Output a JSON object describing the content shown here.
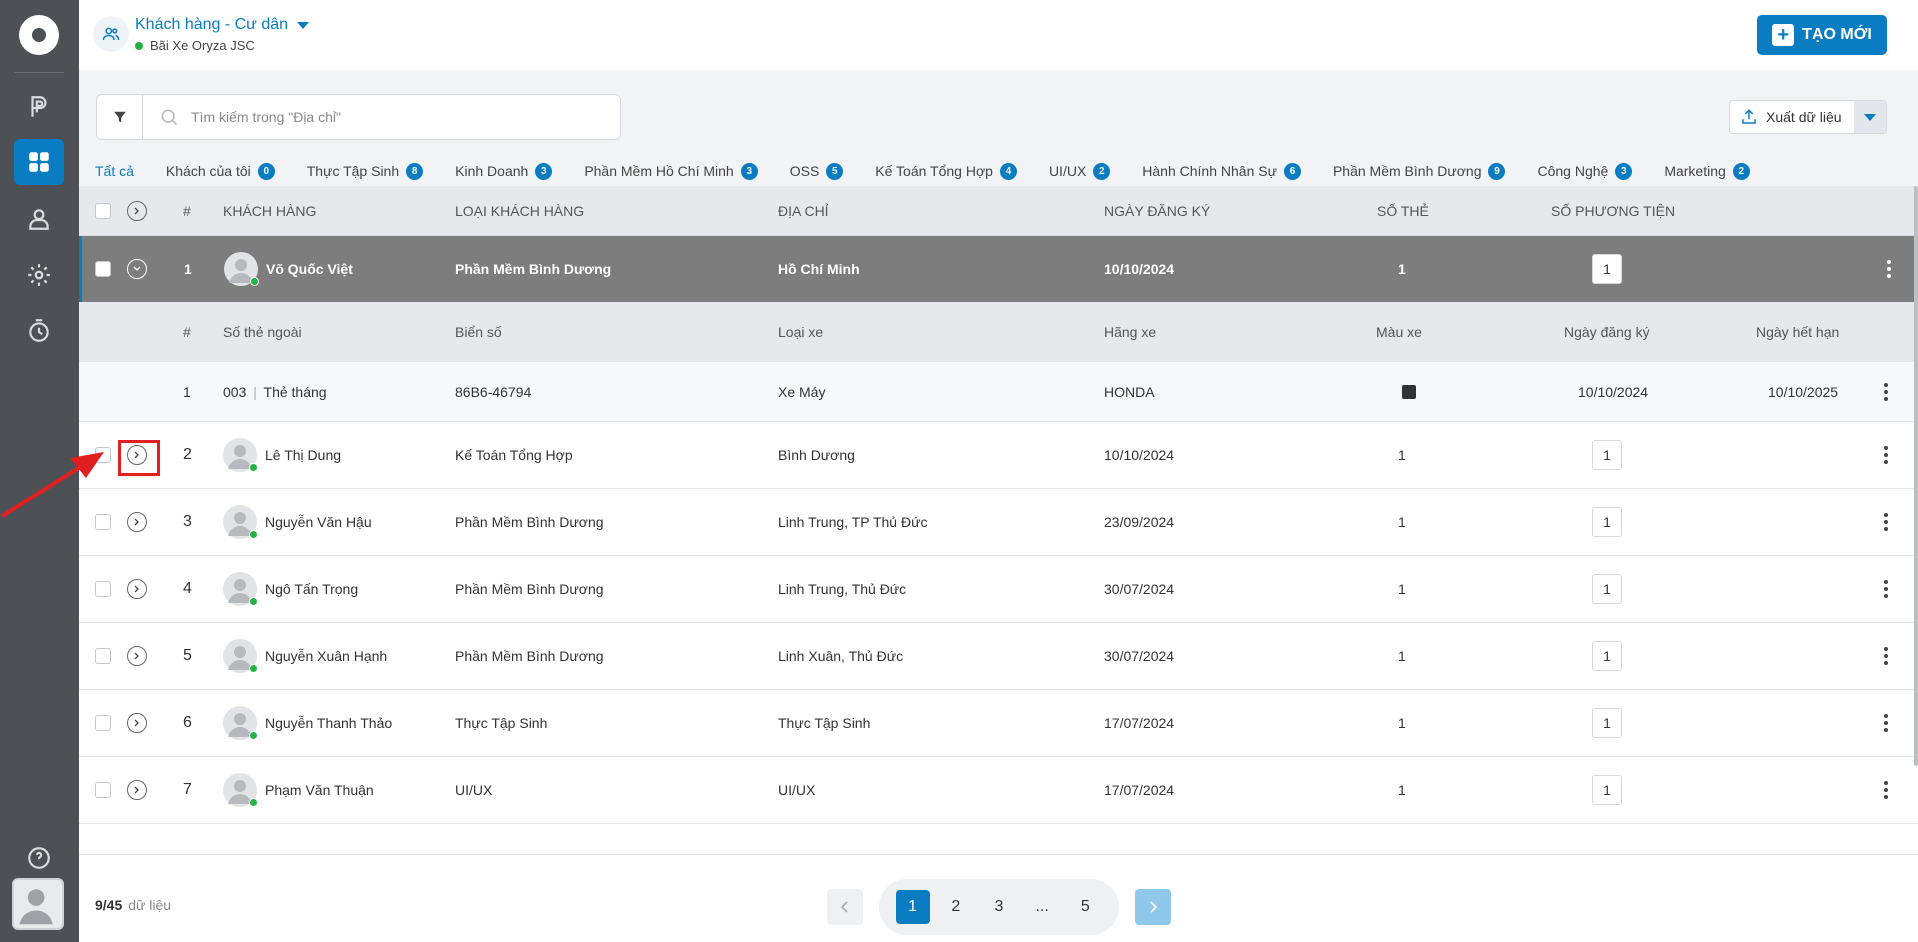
{
  "header": {
    "title": "Khách hàng - Cư dân",
    "subtitle": "Bãi Xe Oryza JSC",
    "create_label": "TẠO MỚI"
  },
  "search": {
    "placeholder": "Tìm kiếm trong \"Địa chỉ\""
  },
  "export": {
    "label": "Xuất dữ liệu"
  },
  "tabs": [
    {
      "label": "Tất cả",
      "badge": ""
    },
    {
      "label": "Khách của tôi",
      "badge": "0"
    },
    {
      "label": "Thực Tập Sinh",
      "badge": "8"
    },
    {
      "label": "Kinh Doanh",
      "badge": "3"
    },
    {
      "label": "Phần Mềm Hồ Chí Minh",
      "badge": "3"
    },
    {
      "label": "OSS",
      "badge": "5"
    },
    {
      "label": "Kế Toán Tổng Hợp",
      "badge": "4"
    },
    {
      "label": "UI/UX",
      "badge": "2"
    },
    {
      "label": "Hành Chính Nhân Sự",
      "badge": "6"
    },
    {
      "label": "Phần Mềm Bình Dương",
      "badge": "9"
    },
    {
      "label": "Công Nghệ",
      "badge": "3"
    },
    {
      "label": "Marketing",
      "badge": "2"
    }
  ],
  "table": {
    "columns": {
      "index": "#",
      "customer": "KHÁCH HÀNG",
      "type": "LOẠI KHÁCH HÀNG",
      "address": "ĐỊA CHỈ",
      "date": "NGÀY ĐĂNG KÝ",
      "cards": "SỐ THẺ",
      "vehicles": "SỐ PHƯƠNG TIỆN"
    },
    "expanded_row": {
      "index": "1",
      "name": "Võ Quốc Việt",
      "type": "Phần Mềm Bình Dương",
      "address": "Hồ Chí Minh",
      "date": "10/10/2024",
      "cards": "1",
      "vehicles": "1"
    },
    "sub_columns": {
      "index": "#",
      "ext_card": "Số thẻ ngoài",
      "plate": "Biển số",
      "vehicle_type": "Loại xe",
      "brand": "Hãng xe",
      "color": "Màu xe",
      "reg_date": "Ngày đăng ký",
      "exp_date": "Ngày hết hạn"
    },
    "sub_row": {
      "index": "1",
      "card_code": "003",
      "card_type": "Thẻ tháng",
      "plate": "86B6-46794",
      "vehicle_type": "Xe Máy",
      "brand": "HONDA",
      "color_hex": "#333333",
      "reg_date": "10/10/2024",
      "exp_date": "10/10/2025"
    },
    "rows": [
      {
        "index": "2",
        "name": "Lê Thị Dung",
        "type": "Kế Toán Tổng Hợp",
        "address": "Bình Dương",
        "date": "10/10/2024",
        "cards": "1",
        "vehicles": "1"
      },
      {
        "index": "3",
        "name": "Nguyễn Văn Hậu",
        "type": "Phần Mềm Bình Dương",
        "address": "Linh Trung, TP Thủ Đức",
        "date": "23/09/2024",
        "cards": "1",
        "vehicles": "1"
      },
      {
        "index": "4",
        "name": "Ngô Tấn Trọng",
        "type": "Phần Mềm Bình Dương",
        "address": "Linh Trung, Thủ Đức",
        "date": "30/07/2024",
        "cards": "1",
        "vehicles": "1"
      },
      {
        "index": "5",
        "name": "Nguyễn Xuân Hạnh",
        "type": "Phần Mềm Bình Dương",
        "address": "Linh Xuân, Thủ Đức",
        "date": "30/07/2024",
        "cards": "1",
        "vehicles": "1"
      },
      {
        "index": "6",
        "name": "Nguyễn Thanh Thảo",
        "type": "Thực Tập Sinh",
        "address": "Thực Tập Sinh",
        "date": "17/07/2024",
        "cards": "1",
        "vehicles": "1"
      },
      {
        "index": "7",
        "name": "Phạm Văn Thuận",
        "type": "UI/UX",
        "address": "UI/UX",
        "date": "17/07/2024",
        "cards": "1",
        "vehicles": "1"
      }
    ]
  },
  "footer": {
    "count": "9/45",
    "count_label": "dữ liệu",
    "pages": [
      "1",
      "2",
      "3",
      "...",
      "5"
    ],
    "current_page": "1"
  },
  "colors": {
    "primary": "#0a7cc1",
    "sidebar": "#4d5156",
    "online": "#24b247",
    "highlight": "#e02020"
  }
}
